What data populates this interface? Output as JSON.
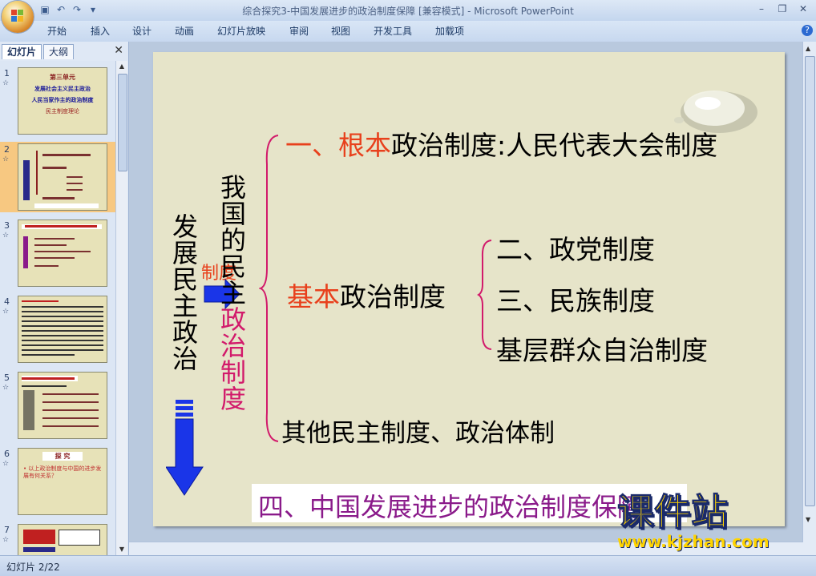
{
  "window": {
    "title": "综合探究3-中国发展进步的政治制度保障 [兼容模式] - Microsoft PowerPoint"
  },
  "ribbon": {
    "tabs": [
      "开始",
      "插入",
      "设计",
      "动画",
      "幻灯片放映",
      "审阅",
      "视图",
      "开发工具",
      "加载项"
    ]
  },
  "left_pane": {
    "tabs": [
      "幻灯片",
      "大纲"
    ],
    "slide_numbers": [
      "1",
      "2",
      "3",
      "4",
      "5",
      "6",
      "7"
    ],
    "thumb1": {
      "title": "第三单元",
      "line1": "发展社会主义民主政治",
      "line2": "人民当家作主的政治制度",
      "line3": "民主制度理论"
    },
    "thumb6": {
      "title": "探 究",
      "text": "• 以上政治制度与中国的进步发展有何关系？"
    }
  },
  "slide": {
    "left_vertical": "发展民主政治",
    "arrow_label": "制度",
    "middle_vertical_black": "我国的民主",
    "middle_vertical_red": "政治制度",
    "line1_prefix": "一、",
    "line1_red": "根本",
    "line1_rest": "政治制度:人民代表大会制度",
    "basic_red": "基本",
    "basic_rest": "政治制度",
    "sub_items": [
      "二、政党制度",
      "三、民族制度",
      "基层群众自治制度"
    ],
    "other": "其他民主制度、政治体制",
    "banner": "四、中国发展进步的政治制度保障"
  },
  "watermark": {
    "brand": "课件站",
    "url": "www.kjzhan.com"
  },
  "status": {
    "slide_indicator": "幻灯片 2/22"
  },
  "colors": {
    "red": "#e8401c",
    "magenta": "#d21a6b",
    "purple": "#8a1a8a",
    "blue_arrow": "#1a35e8",
    "slide_bg": "#e6e4c9"
  }
}
